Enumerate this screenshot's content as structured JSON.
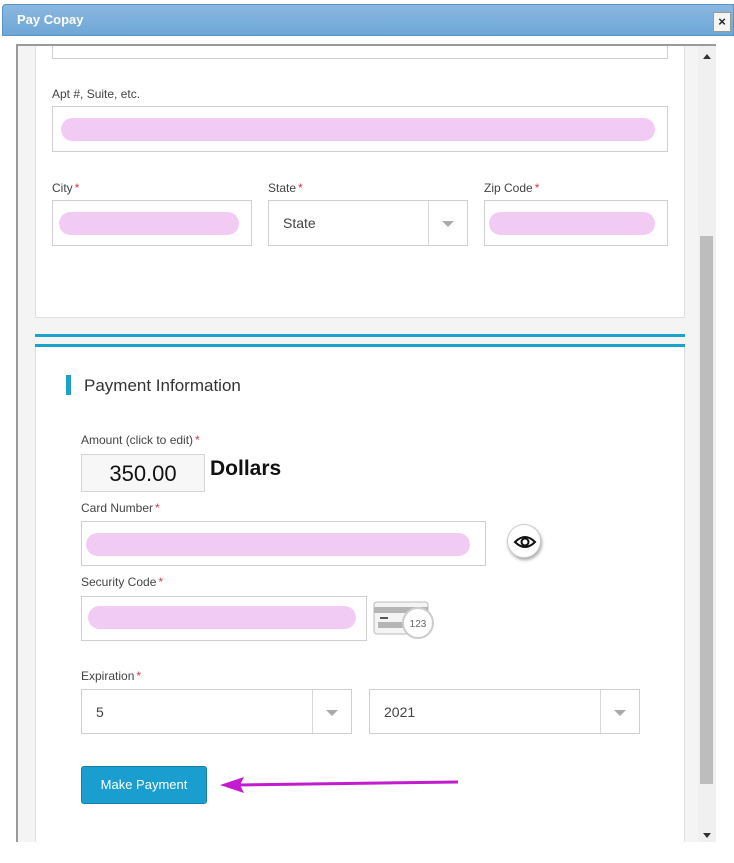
{
  "window": {
    "title": "Pay Copay",
    "close_label": "×"
  },
  "address": {
    "apt_label": "Apt #, Suite, etc.",
    "city_label": "City",
    "state_label": "State",
    "state_value": "State",
    "zip_label": "Zip Code",
    "required_mark": "*"
  },
  "payment": {
    "section_title": "Payment Information",
    "amount_label": "Amount (click to edit)",
    "amount_value": "350.00",
    "amount_unit": "Dollars",
    "card_number_label": "Card Number",
    "security_code_label": "Security Code",
    "cvv_hint_text": "123",
    "expiration_label": "Expiration",
    "exp_month": "5",
    "exp_year": "2021",
    "submit_label": "Make Payment"
  },
  "annotation": {
    "arrow_color": "#c21ccf"
  },
  "colors": {
    "accent": "#1aa1cc",
    "redaction": "#f2cbf5",
    "required": "#e2304f"
  }
}
